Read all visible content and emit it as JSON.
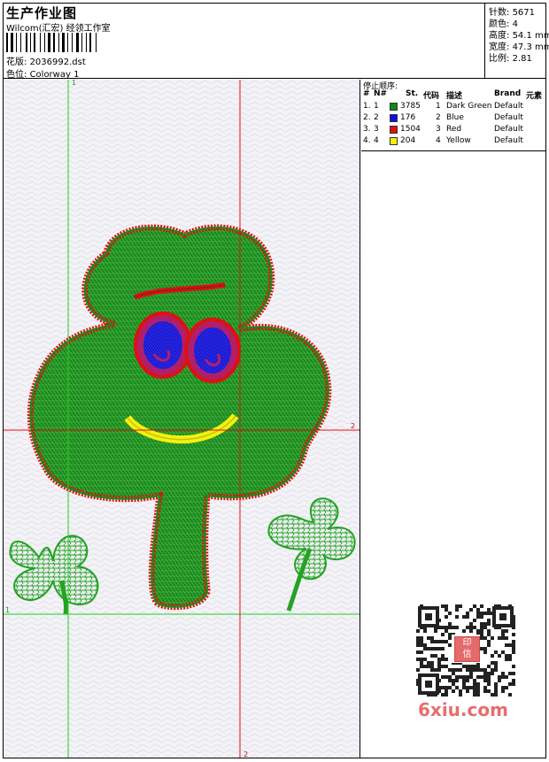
{
  "header": {
    "title": "生产作业图",
    "company": "Wilcom(汇宏) 经领工作室",
    "pattern_label": "花版:",
    "pattern_value": "2036992.dst",
    "colorway_label": "色位:",
    "colorway_value": "Colorway 1"
  },
  "stats": {
    "stitches_label": "针数:",
    "stitches_value": "5671",
    "colors_label": "颜色:",
    "colors_value": "4",
    "height_label": "高度:",
    "height_value": "54.1 mm",
    "width_label": "宽度:",
    "width_value": "47.3 mm",
    "scale_label": "比例:",
    "scale_value": "2.81"
  },
  "design": {
    "guide_label_1": "1",
    "guide_label_2": "2",
    "guide_color_green": "#1fd01f",
    "guide_color_red": "#e01010"
  },
  "stop_sequence": {
    "title": "停止顺序:",
    "columns": [
      "#",
      "N#",
      "St.",
      "代码",
      "描述",
      "Brand",
      "元素"
    ],
    "rows": [
      {
        "n": "1.",
        "num": "1",
        "color": "#0f8a0f",
        "st": "3785",
        "code": "1",
        "desc": "Dark Green",
        "brand": "Default"
      },
      {
        "n": "2.",
        "num": "2",
        "color": "#1010e0",
        "st": "176",
        "code": "2",
        "desc": "Blue",
        "brand": "Default"
      },
      {
        "n": "3.",
        "num": "3",
        "color": "#e01010",
        "st": "1504",
        "code": "3",
        "desc": "Red",
        "brand": "Default"
      },
      {
        "n": "4.",
        "num": "4",
        "color": "#f4f010",
        "st": "204",
        "code": "4",
        "desc": "Yellow",
        "brand": "Default"
      }
    ]
  },
  "watermark": {
    "text": "6xiu.com",
    "seal_line1": "印",
    "seal_line2": "信"
  }
}
